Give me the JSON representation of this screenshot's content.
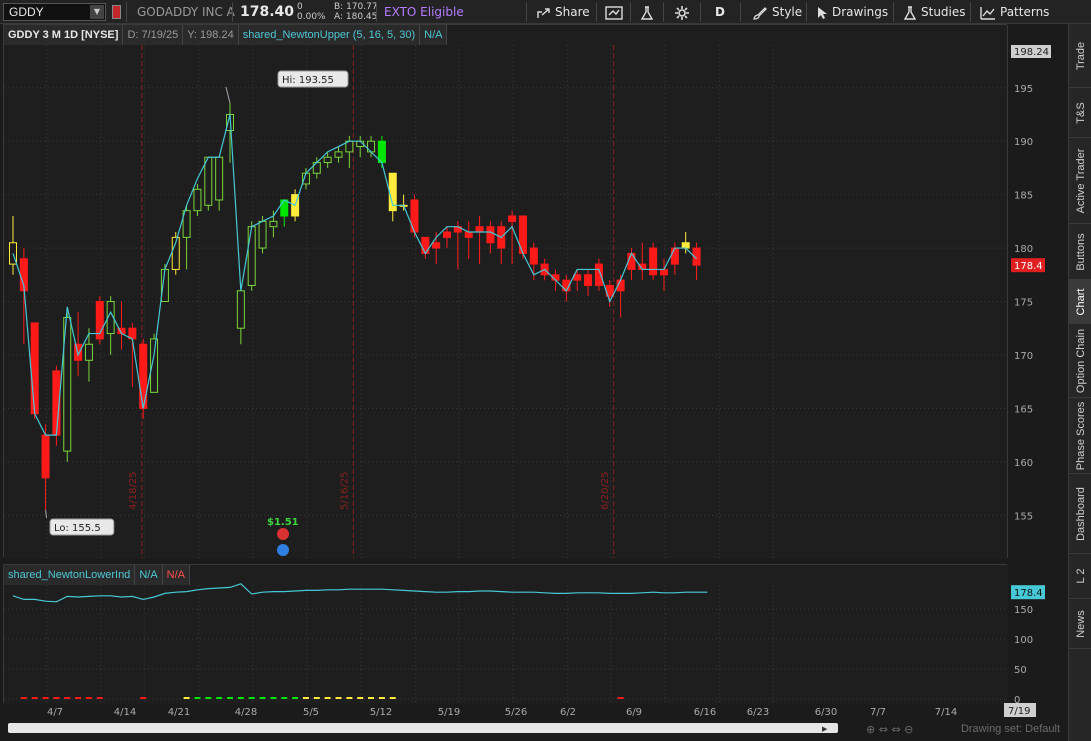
{
  "toolbar": {
    "symbol": "GDDY",
    "company": "GODADDY INC A",
    "last_price": "178.40",
    "change_top": "0",
    "change_pct": "0.00%",
    "bid": "B: 170.77",
    "ask": "A: 180.45",
    "exto": "EXTO Eligible",
    "share": "Share",
    "period": "D",
    "style": "Style",
    "drawings": "Drawings",
    "studies": "Studies",
    "patterns": "Patterns"
  },
  "price_panel": {
    "header": {
      "symbol_desc": "GDDY 3 M 1D [NYSE]",
      "date": "D: 7/19/25",
      "yval": "Y: 198.24",
      "study": "shared_NewtonUpper (5, 16, 5, 30)",
      "study_val": "N/A"
    },
    "top_label": "198.24",
    "last_label": "178.4",
    "hi_label": "Hi: 193.55",
    "lo_label": "Lo: 155.5",
    "dividend_label": "$1.51",
    "vlines": [
      "4/18/25",
      "5/16/25",
      "6/20/25"
    ]
  },
  "lower_panel": {
    "header": {
      "study": "shared_NewtonLowerInd",
      "v1": "N/A",
      "v2": "N/A"
    },
    "last_label": "178.4"
  },
  "x_axis": {
    "labels": [
      "4/7",
      "4/14",
      "4/21",
      "4/28",
      "5/5",
      "5/12",
      "5/19",
      "5/26",
      "6/2",
      "6/9",
      "6/16",
      "6/23",
      "6/30",
      "7/7",
      "7/14"
    ],
    "current": "7/19"
  },
  "bottom": {
    "drawing_set": "Drawing set: Default"
  },
  "tabs": [
    "Trade",
    "T&S",
    "Active Trader",
    "Buttons",
    "Chart",
    "Option Chain",
    "Phase Scores",
    "Dashboard",
    "L 2",
    "News"
  ],
  "chart_data": {
    "type": "candlestick",
    "ylim": [
      151,
      199
    ],
    "yticks": [
      155,
      160,
      165,
      170,
      175,
      180,
      185,
      190,
      195
    ],
    "lower_ylim": [
      0,
      190
    ],
    "lower_yticks": [
      0,
      50,
      100,
      150
    ],
    "colors": {
      "up_yellow": "#ffeb3b",
      "up_green": "#00e600",
      "down_red": "#ff1a1a",
      "hollow_green": "#7bd63b",
      "line": "#47c8d6"
    },
    "candles": [
      {
        "d": "4/2",
        "o": 180.5,
        "h": 183,
        "l": 177.5,
        "c": 178.5,
        "t": "hy"
      },
      {
        "d": "4/3",
        "o": 179,
        "h": 180,
        "l": 171,
        "c": 176,
        "t": "r"
      },
      {
        "d": "4/4",
        "o": 173,
        "h": 173,
        "l": 164,
        "c": 164.5,
        "t": "r"
      },
      {
        "d": "4/7",
        "o": 162.5,
        "h": 163.5,
        "l": 155.5,
        "c": 158.5,
        "t": "r"
      },
      {
        "d": "4/8",
        "o": 168.5,
        "h": 169,
        "l": 161.5,
        "c": 162.5,
        "t": "r"
      },
      {
        "d": "4/9",
        "o": 161,
        "h": 174,
        "l": 160,
        "c": 173.5,
        "t": "hg"
      },
      {
        "d": "4/10",
        "o": 171,
        "h": 174,
        "l": 168,
        "c": 169.5,
        "t": "r"
      },
      {
        "d": "4/11",
        "o": 169.5,
        "h": 172.5,
        "l": 167.5,
        "c": 171,
        "t": "hg"
      },
      {
        "d": "4/14",
        "o": 175,
        "h": 175.5,
        "l": 171,
        "c": 171.5,
        "t": "r"
      },
      {
        "d": "4/15",
        "o": 172,
        "h": 175.5,
        "l": 170,
        "c": 175,
        "t": "hg"
      },
      {
        "d": "4/16",
        "o": 172.5,
        "h": 175,
        "l": 170.5,
        "c": 172,
        "t": "r"
      },
      {
        "d": "4/17",
        "o": 172.5,
        "h": 173,
        "l": 167,
        "c": 171.5,
        "t": "r"
      },
      {
        "d": "4/21",
        "o": 171,
        "h": 171.5,
        "l": 164,
        "c": 165,
        "t": "r"
      },
      {
        "d": "4/22",
        "o": 166.5,
        "h": 172,
        "l": 166.5,
        "c": 171.5,
        "t": "hg"
      },
      {
        "d": "4/23",
        "o": 175,
        "h": 178.5,
        "l": 175,
        "c": 178,
        "t": "hg"
      },
      {
        "d": "4/24",
        "o": 178,
        "h": 181.5,
        "l": 177.5,
        "c": 181,
        "t": "hy"
      },
      {
        "d": "4/25",
        "o": 181,
        "h": 184,
        "l": 178,
        "c": 183.5,
        "t": "hg"
      },
      {
        "d": "4/28",
        "o": 183.5,
        "h": 186,
        "l": 183,
        "c": 185.5,
        "t": "hg"
      },
      {
        "d": "4/29",
        "o": 184,
        "h": 188.5,
        "l": 183.5,
        "c": 188.5,
        "t": "hg"
      },
      {
        "d": "4/30",
        "o": 184.5,
        "h": 188.5,
        "l": 183.5,
        "c": 188.5,
        "t": "hg"
      },
      {
        "d": "5/1",
        "o": 191,
        "h": 193.55,
        "l": 188,
        "c": 192.5,
        "t": "hg"
      },
      {
        "d": "5/2",
        "o": 172.5,
        "h": 176,
        "l": 171,
        "c": 176,
        "t": "hg"
      },
      {
        "d": "5/5",
        "o": 176.5,
        "h": 182.5,
        "l": 176,
        "c": 182,
        "t": "hg"
      },
      {
        "d": "5/6",
        "o": 180,
        "h": 183,
        "l": 179.5,
        "c": 182.5,
        "t": "hg"
      },
      {
        "d": "5/7",
        "o": 182,
        "h": 183.5,
        "l": 181,
        "c": 182.5,
        "t": "hg"
      },
      {
        "d": "5/8",
        "o": 183,
        "h": 184.5,
        "l": 182,
        "c": 184.5,
        "t": "g"
      },
      {
        "d": "5/9",
        "o": 183,
        "h": 185.5,
        "l": 182.5,
        "c": 185,
        "t": "y"
      },
      {
        "d": "5/12",
        "o": 186,
        "h": 187.5,
        "l": 185.5,
        "c": 187,
        "t": "hg"
      },
      {
        "d": "5/13",
        "o": 187,
        "h": 188.5,
        "l": 186.5,
        "c": 188,
        "t": "hg"
      },
      {
        "d": "5/14",
        "o": 188,
        "h": 189,
        "l": 187.5,
        "c": 188.5,
        "t": "hg"
      },
      {
        "d": "5/15",
        "o": 188.5,
        "h": 189.5,
        "l": 188,
        "c": 189,
        "t": "hg"
      },
      {
        "d": "5/16",
        "o": 189,
        "h": 190.5,
        "l": 187.5,
        "c": 190,
        "t": "hg"
      },
      {
        "d": "5/19",
        "o": 189.5,
        "h": 190.5,
        "l": 188.5,
        "c": 190,
        "t": "hg"
      },
      {
        "d": "5/20",
        "o": 190,
        "h": 190.5,
        "l": 188.5,
        "c": 189,
        "t": "hg"
      },
      {
        "d": "5/21",
        "o": 190,
        "h": 190.5,
        "l": 187.5,
        "c": 188,
        "t": "g"
      },
      {
        "d": "5/22",
        "o": 187,
        "h": 187,
        "l": 182.5,
        "c": 183.5,
        "t": "y"
      },
      {
        "d": "5/23",
        "o": 184,
        "h": 185,
        "l": 183.5,
        "c": 184,
        "t": "y"
      },
      {
        "d": "5/27",
        "o": 184.5,
        "h": 185,
        "l": 181,
        "c": 181.5,
        "t": "r"
      },
      {
        "d": "5/28",
        "o": 181,
        "h": 181,
        "l": 179,
        "c": 179.5,
        "t": "r"
      },
      {
        "d": "5/29",
        "o": 180.5,
        "h": 181.5,
        "l": 178.5,
        "c": 180,
        "t": "r"
      },
      {
        "d": "5/30",
        "o": 181.5,
        "h": 182,
        "l": 180,
        "c": 181,
        "t": "r"
      },
      {
        "d": "6/2",
        "o": 182,
        "h": 182.5,
        "l": 178,
        "c": 181.5,
        "t": "r"
      },
      {
        "d": "6/3",
        "o": 181.5,
        "h": 182.5,
        "l": 179,
        "c": 181,
        "t": "r"
      },
      {
        "d": "6/4",
        "o": 182,
        "h": 183,
        "l": 178.5,
        "c": 181.5,
        "t": "r"
      },
      {
        "d": "6/5",
        "o": 182,
        "h": 182.5,
        "l": 179.5,
        "c": 180.5,
        "t": "r"
      },
      {
        "d": "6/6",
        "o": 182,
        "h": 182.5,
        "l": 178.5,
        "c": 180,
        "t": "r"
      },
      {
        "d": "6/9",
        "o": 183,
        "h": 183.5,
        "l": 178.5,
        "c": 182.5,
        "t": "r"
      },
      {
        "d": "6/10",
        "o": 183,
        "h": 183,
        "l": 179,
        "c": 179.5,
        "t": "r"
      },
      {
        "d": "6/11",
        "o": 180,
        "h": 180.5,
        "l": 177,
        "c": 178.5,
        "t": "r"
      },
      {
        "d": "6/12",
        "o": 178.5,
        "h": 179,
        "l": 177,
        "c": 177.5,
        "t": "r"
      },
      {
        "d": "6/13",
        "o": 177.5,
        "h": 178,
        "l": 176,
        "c": 177,
        "t": "r"
      },
      {
        "d": "6/16",
        "o": 177,
        "h": 177.5,
        "l": 175,
        "c": 176,
        "t": "r"
      },
      {
        "d": "6/17",
        "o": 177.5,
        "h": 178,
        "l": 176,
        "c": 177,
        "t": "r"
      },
      {
        "d": "6/18",
        "o": 177.5,
        "h": 178,
        "l": 175.5,
        "c": 176.5,
        "t": "r"
      },
      {
        "d": "6/20",
        "o": 178.5,
        "h": 179,
        "l": 176,
        "c": 176.5,
        "t": "r"
      },
      {
        "d": "6/23",
        "o": 176.5,
        "h": 177,
        "l": 174.5,
        "c": 175.5,
        "t": "r"
      },
      {
        "d": "6/24",
        "o": 176,
        "h": 177.5,
        "l": 173.5,
        "c": 177,
        "t": "r"
      },
      {
        "d": "6/25",
        "o": 178,
        "h": 180,
        "l": 177,
        "c": 179.5,
        "t": "r"
      },
      {
        "d": "6/26",
        "o": 178.5,
        "h": 180.5,
        "l": 177,
        "c": 178,
        "t": "r"
      },
      {
        "d": "6/27",
        "o": 180,
        "h": 180.5,
        "l": 177,
        "c": 177.5,
        "t": "r"
      },
      {
        "d": "6/30",
        "o": 178,
        "h": 179,
        "l": 176,
        "c": 177.5,
        "t": "r"
      },
      {
        "d": "7/1",
        "o": 178.5,
        "h": 180.5,
        "l": 177.5,
        "c": 180,
        "t": "r"
      },
      {
        "d": "7/2",
        "o": 180.5,
        "h": 181.5,
        "l": 179.5,
        "c": 180,
        "t": "y"
      },
      {
        "d": "7/3",
        "o": 180,
        "h": 180.5,
        "l": 177,
        "c": 178.4,
        "t": "r"
      }
    ],
    "line": [
      179.5,
      176.5,
      164.5,
      162.5,
      162.5,
      174.5,
      170,
      172,
      172,
      174,
      172,
      171.5,
      165,
      170,
      178,
      180.5,
      184,
      186.5,
      188.5,
      188.5,
      192.5,
      176,
      182,
      182.5,
      183,
      184.5,
      184,
      187,
      188,
      189,
      189.5,
      190,
      190,
      189,
      188,
      184,
      184,
      181.5,
      179.5,
      181,
      182,
      182,
      181.5,
      181.5,
      181.5,
      181,
      182,
      179.5,
      177.5,
      178,
      177,
      176,
      178,
      178,
      178,
      175,
      177,
      179.5,
      178,
      178,
      178,
      180,
      180,
      179
    ],
    "lower_line": [
      172,
      166,
      166,
      163,
      162,
      171,
      170,
      171,
      172,
      172,
      170,
      171,
      166,
      170,
      176,
      178,
      179,
      182,
      184,
      185,
      186,
      192,
      175,
      178,
      179,
      179,
      180,
      181,
      181,
      182,
      182,
      183,
      183,
      183,
      183,
      182,
      181,
      180,
      179,
      178,
      178,
      179,
      179,
      180,
      180,
      179,
      178,
      178,
      178,
      177,
      176,
      176,
      177,
      177,
      177,
      176,
      176,
      176,
      177,
      178,
      177,
      177,
      178,
      178,
      178
    ],
    "lower_bars": [
      {
        "i": 1,
        "c": "#ff1a1a"
      },
      {
        "i": 2,
        "c": "#ff1a1a"
      },
      {
        "i": 3,
        "c": "#ff1a1a"
      },
      {
        "i": 4,
        "c": "#ff1a1a"
      },
      {
        "i": 5,
        "c": "#ff1a1a"
      },
      {
        "i": 6,
        "c": "#ff1a1a"
      },
      {
        "i": 7,
        "c": "#ff1a1a"
      },
      {
        "i": 8,
        "c": "#ff1a1a"
      },
      {
        "i": 12,
        "c": "#ff1a1a"
      },
      {
        "i": 16,
        "c": "#ffeb3b"
      },
      {
        "i": 17,
        "c": "#00e600"
      },
      {
        "i": 18,
        "c": "#00e600"
      },
      {
        "i": 19,
        "c": "#00e600"
      },
      {
        "i": 20,
        "c": "#00e600"
      },
      {
        "i": 21,
        "c": "#00e600"
      },
      {
        "i": 22,
        "c": "#00e600"
      },
      {
        "i": 23,
        "c": "#00e600"
      },
      {
        "i": 24,
        "c": "#00e600"
      },
      {
        "i": 25,
        "c": "#00e600"
      },
      {
        "i": 26,
        "c": "#00e600"
      },
      {
        "i": 27,
        "c": "#ffeb3b"
      },
      {
        "i": 28,
        "c": "#ffeb3b"
      },
      {
        "i": 29,
        "c": "#ffeb3b"
      },
      {
        "i": 30,
        "c": "#ffeb3b"
      },
      {
        "i": 31,
        "c": "#ffeb3b"
      },
      {
        "i": 32,
        "c": "#ffeb3b"
      },
      {
        "i": 33,
        "c": "#ffeb3b"
      },
      {
        "i": 34,
        "c": "#ffeb3b"
      },
      {
        "i": 35,
        "c": "#ffeb3b"
      },
      {
        "i": 56,
        "c": "#ff1a1a"
      }
    ]
  }
}
